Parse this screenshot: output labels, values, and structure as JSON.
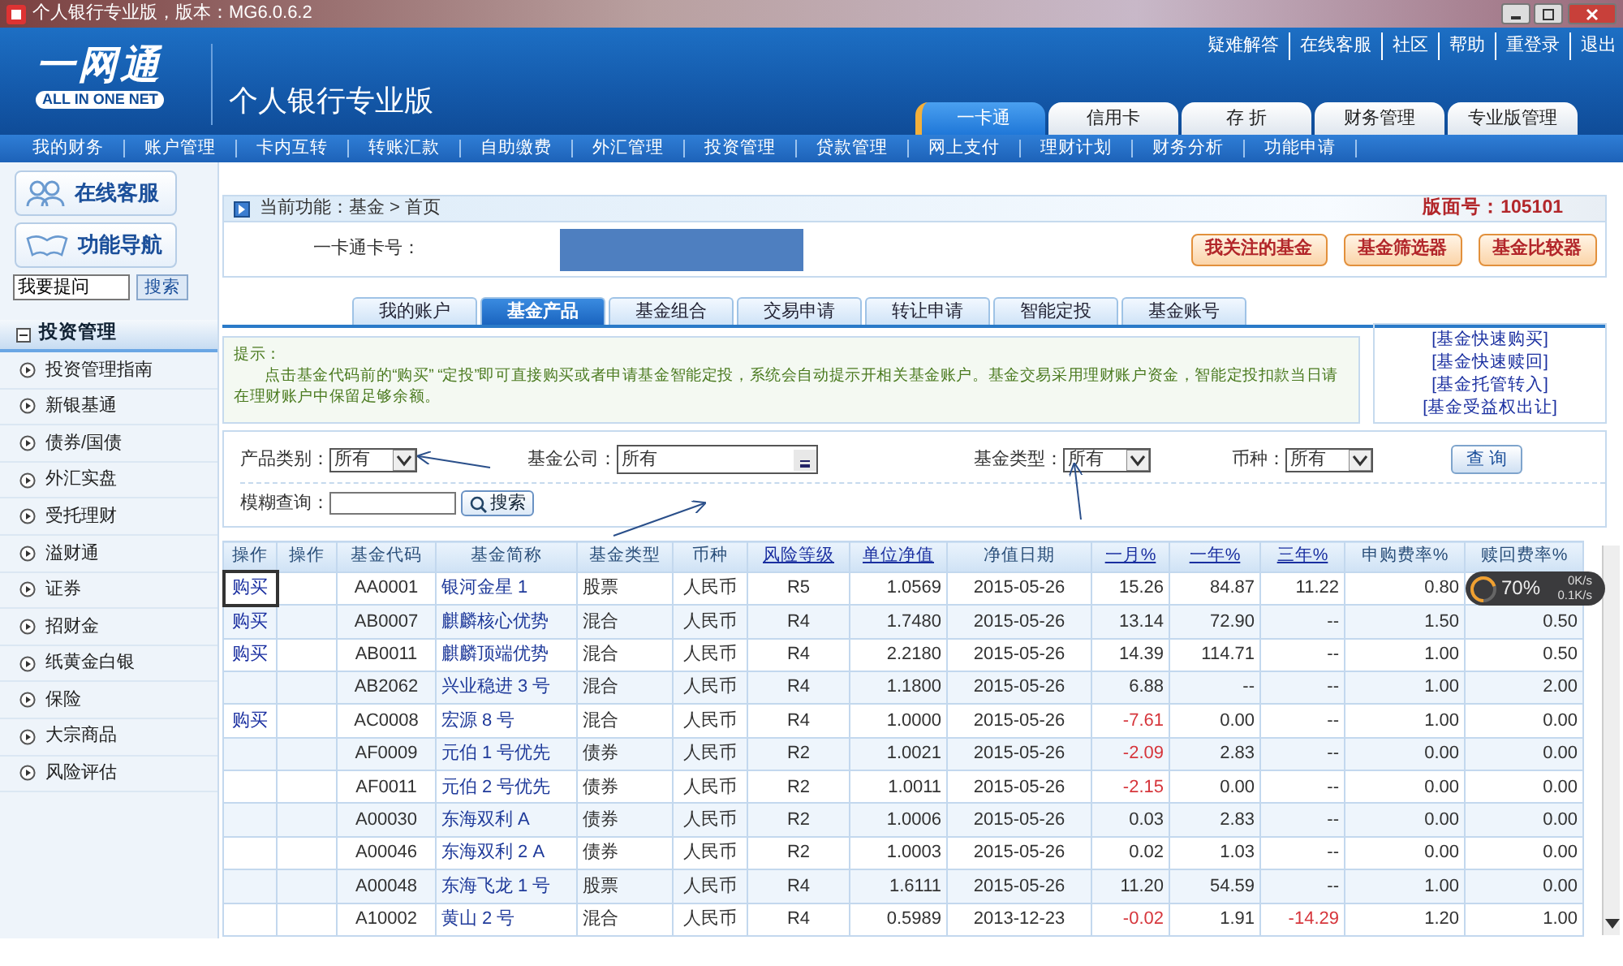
{
  "window": {
    "title": "个人银行专业版，版本：MG6.0.6.2"
  },
  "header": {
    "logo": "一网通",
    "logo_sub": "ALL IN ONE NET",
    "product": "个人银行专业版",
    "links": [
      "疑难解答",
      "在线客服",
      "社区",
      "帮助",
      "重登录",
      "退出"
    ],
    "tabs": [
      {
        "label": "一卡通",
        "selected": true
      },
      {
        "label": "信用卡",
        "selected": false
      },
      {
        "label": "存 折",
        "selected": false
      },
      {
        "label": "财务管理",
        "selected": false
      },
      {
        "label": "专业版管理",
        "selected": false
      }
    ]
  },
  "menu": [
    "我的财务",
    "账户管理",
    "卡内互转",
    "转账汇款",
    "自助缴费",
    "外汇管理",
    "投资管理",
    "贷款管理",
    "网上支付",
    "理财计划",
    "财务分析",
    "功能申请"
  ],
  "sidebar": {
    "buttons": [
      {
        "label": "在线客服",
        "kind": "people"
      },
      {
        "label": "功能导航",
        "kind": "book"
      }
    ],
    "search": {
      "value": "我要提问",
      "button": "搜索"
    },
    "section": {
      "label": "投资管理",
      "expanded": true,
      "items": [
        "投资管理指南",
        "新银基通",
        "债券/国债",
        "外汇实盘",
        "受托理财",
        "溢财通",
        "证券",
        "招财金",
        "纸黄金白银",
        "保险",
        "大宗商品",
        "风险评估"
      ]
    }
  },
  "breadcrumb": {
    "text": "当前功能：基金 > 首页",
    "page_no": "版面号：105101"
  },
  "card": {
    "label": "一卡通卡号：",
    "masked": true
  },
  "actions": [
    "我关注的基金",
    "基金筛选器",
    "基金比较器"
  ],
  "fund_tabs": [
    {
      "label": "我的账户",
      "selected": false
    },
    {
      "label": "基金产品",
      "selected": true
    },
    {
      "label": "基金组合",
      "selected": false
    },
    {
      "label": "交易申请",
      "selected": false
    },
    {
      "label": "转让申请",
      "selected": false
    },
    {
      "label": "智能定投",
      "selected": false
    },
    {
      "label": "基金账号",
      "selected": false
    }
  ],
  "notice": {
    "title": "提示：",
    "text": "点击基金代码前的“购买” “定投”即可直接购买或者申请基金智能定投，系统会自动提示开相关基金账户。基金交易采用理财账户资金，智能定投扣款当日请在理财账户中保留足够余额。"
  },
  "quick_links": [
    "[基金快速购买]",
    "[基金快速赎回]",
    "[基金托管转入]",
    "[基金受益权出让]"
  ],
  "filters": [
    {
      "label": "产品类别：",
      "value": "所有",
      "kind": "select"
    },
    {
      "label": "基金公司：",
      "value": "所有",
      "kind": "combo"
    },
    {
      "label": "基金类型：",
      "value": "所有",
      "kind": "select"
    },
    {
      "label": "币种：",
      "value": "所有",
      "kind": "select"
    }
  ],
  "query_button": "查 询",
  "fuzzy": {
    "label": "模糊查询：",
    "button": "搜索"
  },
  "table": {
    "columns": [
      {
        "label": "操作",
        "link": false
      },
      {
        "label": "操作",
        "link": false
      },
      {
        "label": "基金代码",
        "link": false
      },
      {
        "label": "基金简称",
        "link": false
      },
      {
        "label": "基金类型",
        "link": false
      },
      {
        "label": "币种",
        "link": false
      },
      {
        "label": "风险等级",
        "link": true
      },
      {
        "label": "单位净值",
        "link": true
      },
      {
        "label": "净值日期",
        "link": false
      },
      {
        "label": "一月%",
        "link": true
      },
      {
        "label": "一年%",
        "link": true
      },
      {
        "label": "三年%",
        "link": true
      },
      {
        "label": "申购费率%",
        "link": false
      },
      {
        "label": "赎回费率%",
        "link": false
      }
    ],
    "rows": [
      {
        "outlined": true,
        "cells": [
          "购买",
          "",
          "AA0001",
          "银河金星 1",
          "股票",
          "人民币",
          "R5",
          "1.0569",
          "2015-05-26",
          "15.26",
          "84.87",
          "11.22",
          "0.80"
        ]
      },
      {
        "outlined": false,
        "cells": [
          "购买",
          "",
          "AB0007",
          "麒麟核心优势",
          "混合",
          "人民币",
          "R4",
          "1.7480",
          "2015-05-26",
          "13.14",
          "72.90",
          "--",
          "1.50",
          "0.50"
        ]
      },
      {
        "outlined": false,
        "cells": [
          "购买",
          "",
          "AB0011",
          "麒麟顶端优势",
          "混合",
          "人民币",
          "R4",
          "2.2180",
          "2015-05-26",
          "14.39",
          "114.71",
          "--",
          "1.00",
          "0.50"
        ]
      },
      {
        "outlined": false,
        "cells": [
          "",
          "",
          "AB2062",
          "兴业稳进 3 号",
          "混合",
          "人民币",
          "R4",
          "1.1800",
          "2015-05-26",
          "6.88",
          "--",
          "--",
          "1.00",
          "2.00"
        ]
      },
      {
        "outlined": false,
        "cells": [
          "购买",
          "",
          "AC0008",
          "宏源 8 号",
          "混合",
          "人民币",
          "R4",
          "1.0000",
          "2015-05-26",
          {
            "text": "-7.61",
            "color": "#d6363c"
          },
          "0.00",
          "--",
          "1.00",
          "0.00"
        ]
      },
      {
        "outlined": false,
        "cells": [
          "",
          "",
          "AF0009",
          "元伯 1 号优先",
          "债券",
          "人民币",
          "R2",
          "1.0021",
          "2015-05-26",
          {
            "text": "-2.09",
            "color": "#d6363c"
          },
          "2.83",
          "--",
          "0.00",
          "0.00"
        ]
      },
      {
        "outlined": false,
        "cells": [
          "",
          "",
          "AF0011",
          "元伯 2 号优先",
          "债券",
          "人民币",
          "R2",
          "1.0011",
          "2015-05-26",
          {
            "text": "-2.15",
            "color": "#d6363c"
          },
          "0.00",
          "--",
          "0.00",
          "0.00"
        ]
      },
      {
        "outlined": false,
        "cells": [
          "",
          "",
          "A00030",
          "东海双利 A",
          "债券",
          "人民币",
          "R2",
          "1.0006",
          "2015-05-26",
          "0.03",
          "2.83",
          "--",
          "0.00",
          "0.00"
        ]
      },
      {
        "outlined": false,
        "cells": [
          "",
          "",
          "A00046",
          "东海双利 2 A",
          "债券",
          "人民币",
          "R2",
          "1.0003",
          "2015-05-26",
          "0.02",
          "1.03",
          "--",
          "0.00",
          "0.00"
        ]
      },
      {
        "outlined": false,
        "cells": [
          "",
          "",
          "A00048",
          "东海飞龙 1 号",
          "股票",
          "人民币",
          "R4",
          "1.6111",
          "2015-05-26",
          "11.20",
          "54.59",
          "--",
          "1.00",
          "0.00"
        ]
      },
      {
        "outlined": false,
        "cells": [
          "",
          "",
          "A10002",
          "黄山 2 号",
          "混合",
          "人民币",
          "R4",
          "0.5989",
          "2013-12-23",
          {
            "text": "-0.02",
            "color": "#d6363c"
          },
          "1.91",
          {
            "text": "-14.29",
            "color": "#d6363c"
          },
          "1.20",
          "1.00"
        ]
      }
    ]
  },
  "speed_widget": {
    "percent": "70%",
    "level": 0.7,
    "up": "0K/s",
    "down": "0.1K/s"
  }
}
